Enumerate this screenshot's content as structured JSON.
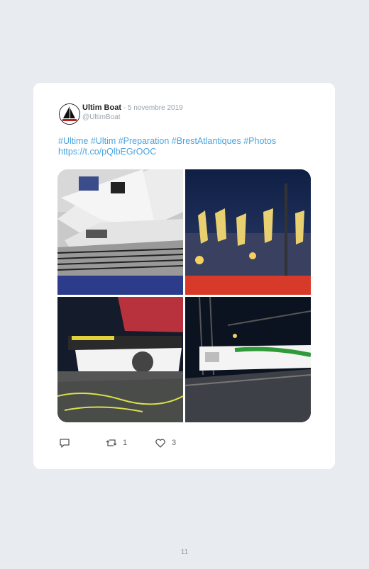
{
  "tweet": {
    "author_name": "Ultim Boat",
    "separator": " - ",
    "date": "5 novembre 2019",
    "handle": "@UltimBoat",
    "text_line1": "#Ultime #Ultim #Preparation #BrestAtlantiques #Photos",
    "text_line2": "https://t.co/pQlbEGrOOC"
  },
  "photos": [
    {
      "icon": "photo-catamaran-deck-day"
    },
    {
      "icon": "photo-trophies-night"
    },
    {
      "icon": "photo-trimaran-hull-night"
    },
    {
      "icon": "photo-trimaran-sail-cover-night"
    }
  ],
  "actions": {
    "reply_icon": "reply-icon",
    "retweet_icon": "retweet-icon",
    "retweet_count": "1",
    "like_icon": "heart-icon",
    "like_count": "3"
  },
  "page_number": "11",
  "colors": {
    "link": "#4aa3df",
    "background": "#e8ebef",
    "card": "#ffffff"
  }
}
